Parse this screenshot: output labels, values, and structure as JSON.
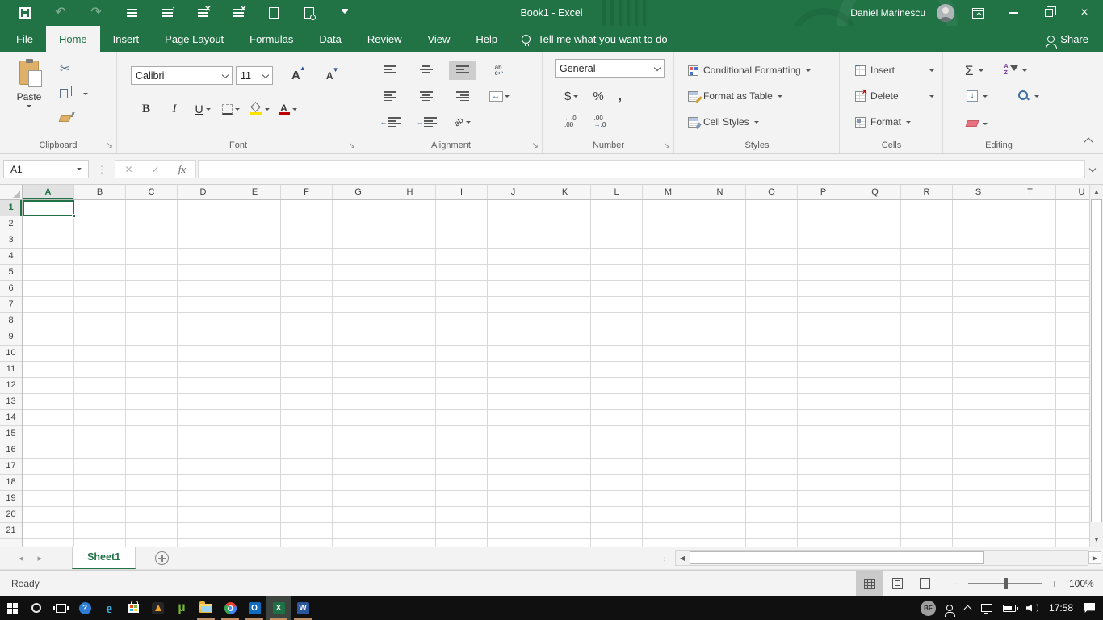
{
  "window": {
    "title": "Book1 - Excel",
    "user_name": "Daniel Marinescu",
    "share_label": "Share"
  },
  "qat": {
    "icons": [
      "save",
      "undo",
      "redo",
      "insert-rows",
      "insert-columns",
      "delete-rows",
      "delete-columns",
      "touch-mode",
      "print-preview",
      "customize-quick-access-toolbar"
    ]
  },
  "ribbon_tabs": {
    "items": [
      "File",
      "Home",
      "Insert",
      "Page Layout",
      "Formulas",
      "Data",
      "Review",
      "View",
      "Help"
    ],
    "active": "Home",
    "tell_me": "Tell me what you want to do"
  },
  "ribbon": {
    "clipboard": {
      "group_label": "Clipboard",
      "paste_label": "Paste"
    },
    "font": {
      "group_label": "Font",
      "font_name": "Calibri",
      "font_size": "11",
      "bold_glyph": "B",
      "italic_glyph": "I",
      "underline_glyph": "U",
      "grow_glyph": "A",
      "shrink_glyph": "A"
    },
    "alignment": {
      "group_label": "Alignment",
      "wrap_top": "ab",
      "wrap_bottom": "c",
      "orientation_glyph": "ab"
    },
    "number": {
      "group_label": "Number",
      "format": "General",
      "currency_glyph": "$",
      "percent_glyph": "%",
      "comma_glyph": ",",
      "inc_top": ".0",
      "inc_bottom": ".00",
      "dec_top": ".00",
      "dec_bottom": ".0"
    },
    "styles": {
      "group_label": "Styles",
      "conditional_formatting_label": "Conditional Formatting",
      "format_as_table_label": "Format as Table",
      "cell_styles_label": "Cell Styles"
    },
    "cells": {
      "group_label": "Cells",
      "insert_label": "Insert",
      "delete_label": "Delete",
      "format_label": "Format"
    },
    "editing": {
      "group_label": "Editing",
      "autosum_glyph": "Σ",
      "sort_a": "A",
      "sort_z": "Z",
      "fill_glyph": "↓"
    }
  },
  "formula_bar": {
    "name_box_value": "A1",
    "fx_label": "fx",
    "formula_value": ""
  },
  "grid": {
    "columns": [
      "A",
      "B",
      "C",
      "D",
      "E",
      "F",
      "G",
      "H",
      "I",
      "J",
      "K",
      "L",
      "M",
      "N",
      "O",
      "P",
      "Q",
      "R",
      "S",
      "T",
      "U"
    ],
    "rows": [
      "1",
      "2",
      "3",
      "4",
      "5",
      "6",
      "7",
      "8",
      "9",
      "10",
      "11",
      "12",
      "13",
      "14",
      "15",
      "16",
      "17",
      "18",
      "19",
      "20",
      "21"
    ],
    "active_cell": "A1"
  },
  "sheet_bar": {
    "active_tab": "Sheet1"
  },
  "status_bar": {
    "status": "Ready",
    "zoom_level": "100%"
  },
  "taskbar": {
    "apps": [
      "start",
      "cortana-search",
      "task-view",
      "get-help",
      "edge",
      "microsoft-store",
      "daemon-tools",
      "utorrent",
      "file-explorer",
      "chrome",
      "outlook",
      "excel",
      "word"
    ],
    "tray_badge": "BF",
    "time": "17:58"
  },
  "colors": {
    "excel_green": "#217346",
    "selection_border": "#217346",
    "fill_color_yellow": "#ffe100",
    "font_color_red": "#c00000",
    "taskbar_running_underline": "#bf8f68"
  }
}
